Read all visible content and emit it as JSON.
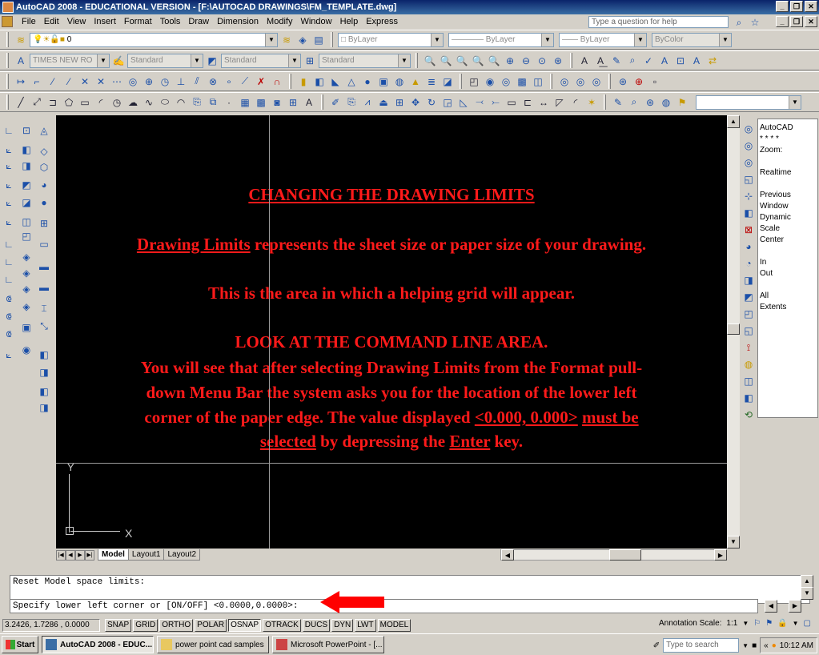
{
  "window": {
    "title": "AutoCAD 2008 - EDUCATIONAL VERSION - [F:\\AUTOCAD DRAWINGS\\FM_TEMPLATE.dwg]"
  },
  "menu": {
    "items": [
      "File",
      "Edit",
      "View",
      "Insert",
      "Format",
      "Tools",
      "Draw",
      "Dimension",
      "Modify",
      "Window",
      "Help",
      "Express"
    ],
    "help_placeholder": "Type a question for help"
  },
  "toolbars": {
    "layer_value": "0",
    "color_value": "ByLayer",
    "linetype_value": "ByLayer",
    "lineweight_value": "ByLayer",
    "plotstyle_value": "ByColor",
    "font_value": "TIMES NEW RO",
    "text_style": "Standard",
    "dim_style": "Standard",
    "table_style": "Standard"
  },
  "slide": {
    "heading": "CHANGING THE DRAWING LIMITS",
    "line1_link": "Drawing Limits",
    "line1_rest": " represents the sheet size or paper size of your drawing.",
    "line2": "This is the area in which a helping grid will appear.",
    "line3": "LOOK AT THE COMMAND LINE AREA.",
    "para_a": "You will see that after selecting Drawing Limits  from the Format pull-",
    "para_b": "down Menu Bar the system asks you for the location of the lower left",
    "para_c": "corner of the paper edge. The value displayed ",
    "value_text": "<0.000, 0.000>",
    "must_be": "must be",
    "selected": "selected",
    "by_depress": " by depressing the ",
    "enter": "Enter",
    "key_end": " key."
  },
  "ucs": {
    "y_label": "Y",
    "x_label": "X"
  },
  "zoom_panel": {
    "lines": [
      "AutoCAD",
      "* * * *",
      "Zoom:",
      "",
      "Realtime",
      "",
      "Previous",
      "Window",
      "Dynamic",
      "Scale",
      "Center",
      "",
      "In",
      "Out",
      "",
      "All",
      "Extents"
    ]
  },
  "layout_tabs": [
    "Model",
    "Layout1",
    "Layout2"
  ],
  "command": {
    "history": "Reset Model space limits:",
    "prompt": "Specify lower left corner or [ON/OFF] <0.0000,0.0000>:"
  },
  "status": {
    "coords": "3.2426, 1.7286 , 0.0000",
    "buttons": [
      "SNAP",
      "GRID",
      "ORTHO",
      "POLAR",
      "OSNAP",
      "OTRACK",
      "DUCS",
      "DYN",
      "LWT",
      "MODEL"
    ],
    "annotation_scale_label": "Annotation Scale:",
    "annotation_scale_value": "1:1"
  },
  "taskbar": {
    "start": "Start",
    "tasks": [
      "AutoCAD 2008 - EDUC...",
      "power point cad samples",
      "Microsoft PowerPoint - [..."
    ],
    "search_placeholder": "Type to search",
    "time": "10:12 AM"
  }
}
